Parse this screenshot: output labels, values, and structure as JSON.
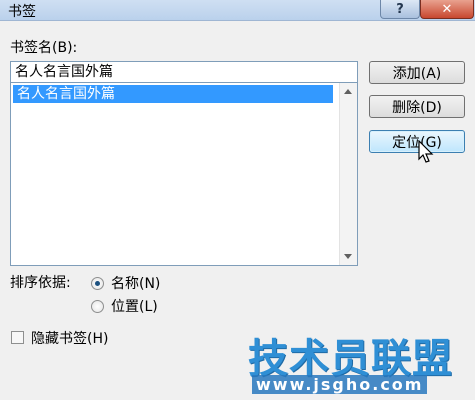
{
  "window": {
    "title": "书签"
  },
  "bookmark_name": {
    "label": "书签名(B):",
    "value": "名人名言国外篇"
  },
  "bookmark_list": {
    "items": [
      "名人名言国外篇"
    ]
  },
  "buttons": {
    "add": "添加(A)",
    "delete": "删除(D)",
    "goto": "定位(G)"
  },
  "sort": {
    "label": "排序依据:",
    "options": [
      {
        "label": "名称(N)",
        "checked": true
      },
      {
        "label": "位置(L)",
        "checked": false
      }
    ]
  },
  "hidden_bookmarks": {
    "label": "隐藏书签(H)",
    "checked": false
  },
  "watermark": {
    "brand": "技术员联盟",
    "url": "www.jsgho.com"
  },
  "colors": {
    "selection": "#3399ff",
    "watermark": "#2f8fd5"
  }
}
